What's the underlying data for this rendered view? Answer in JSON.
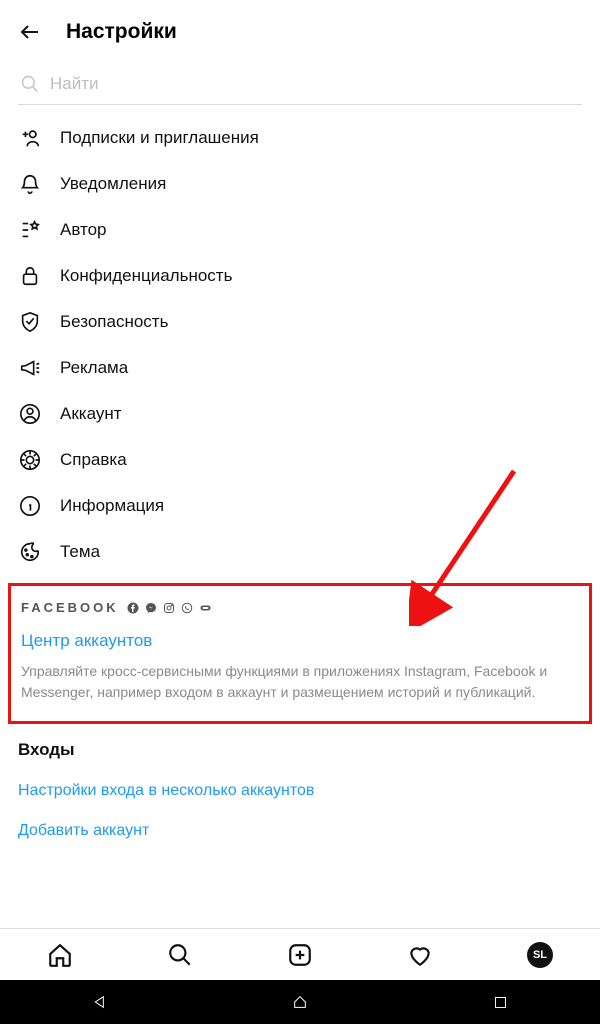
{
  "header": {
    "title": "Настройки"
  },
  "search": {
    "placeholder": "Найти"
  },
  "menu": {
    "items": [
      {
        "label": "Подписки и приглашения",
        "icon": "add-user-icon"
      },
      {
        "label": "Уведомления",
        "icon": "bell-icon"
      },
      {
        "label": "Автор",
        "icon": "star-icon"
      },
      {
        "label": "Конфиденциальность",
        "icon": "lock-icon"
      },
      {
        "label": "Безопасность",
        "icon": "shield-icon"
      },
      {
        "label": "Реклама",
        "icon": "megaphone-icon"
      },
      {
        "label": "Аккаунт",
        "icon": "account-icon"
      },
      {
        "label": "Справка",
        "icon": "help-icon"
      },
      {
        "label": "Информация",
        "icon": "info-icon"
      },
      {
        "label": "Тема",
        "icon": "theme-icon"
      }
    ]
  },
  "facebook_section": {
    "brand": "FACEBOOK",
    "link": "Центр аккаунтов",
    "description": "Управляйте кросс-сервисными функциями в приложениях Instagram, Facebook и Messenger, например входом в аккаунт и размещением историй и публикаций."
  },
  "logins": {
    "heading": "Входы",
    "multi": "Настройки входа в несколько аккаунтов",
    "add": "Добавить аккаунт"
  },
  "avatar_initials": "SL",
  "colors": {
    "accent": "#1f9bf0",
    "highlight": "#e11"
  }
}
